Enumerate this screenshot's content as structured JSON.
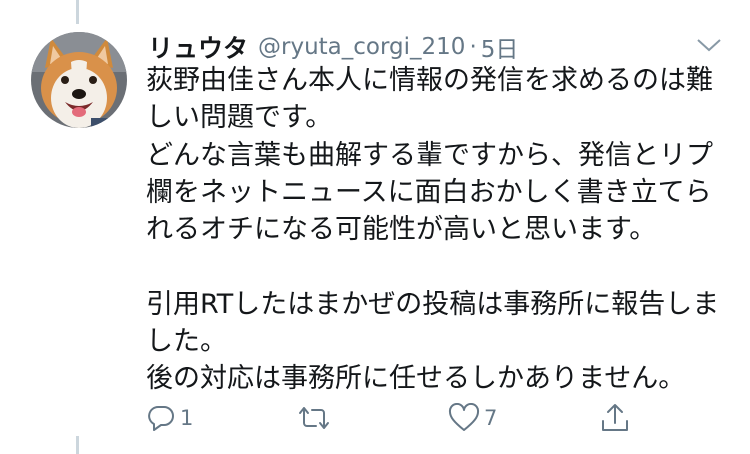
{
  "tweet": {
    "display_name": "リュウタ",
    "handle": "@ryuta_corgi_210",
    "separator": "·",
    "time": "5日",
    "text_lines": [
      "荻野由佳さん本人に情報の発信を求めるのは難",
      "しい問題です。",
      "どんな言葉も曲解する輩ですから、発信とリプ",
      "欄をネットニュースに面白おかしく書き立てら",
      "れるオチになる可能性が高いと思います。",
      "",
      "引用RTしたはまかぜの投稿は事務所に報告しま",
      "した。",
      "後の対応は事務所に任せるしかありません。"
    ],
    "reply_count": "1",
    "retweet_count": "",
    "like_count": "7"
  },
  "icons": {
    "avatar": "corgi-avatar",
    "caret": "chevron-down-icon",
    "reply": "reply-icon",
    "retweet": "retweet-icon",
    "like": "heart-icon",
    "share": "share-icon"
  },
  "colors": {
    "text": "#14171a",
    "secondary": "#657786",
    "thread_line": "#ccd6dd"
  }
}
